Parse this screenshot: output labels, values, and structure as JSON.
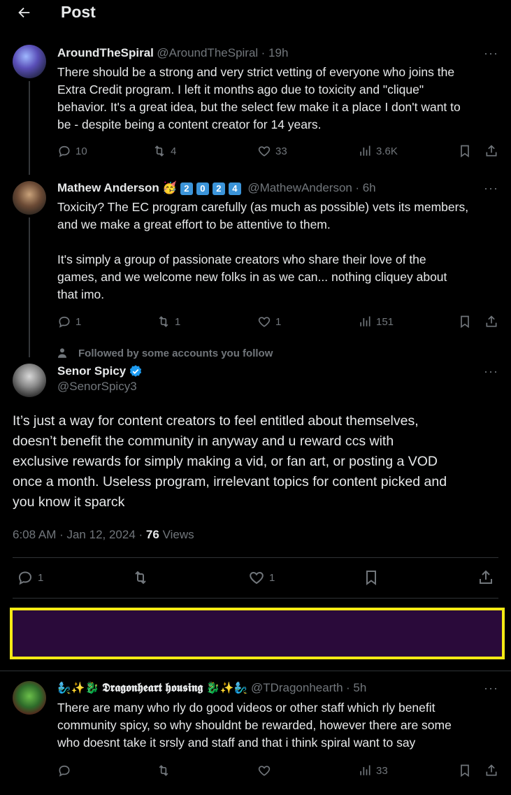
{
  "header": {
    "title": "Post"
  },
  "tweet1": {
    "name": "AroundTheSpiral",
    "handle": "@AroundTheSpiral",
    "time": "· 19h",
    "text_lines": [
      "There should be a strong and very strict vetting of everyone who joins the",
      "Extra Credit program. I left it months ago due to toxicity and \"clique\"",
      "behavior. It's a great idea, but the select few make it a place I don't want to",
      "be - despite being a content creator for 14 years."
    ],
    "replies": "10",
    "reposts": "4",
    "likes": "33",
    "views": "3.6K"
  },
  "tweet2": {
    "name": "Mathew Anderson",
    "emoji": "🥳",
    "badges": [
      "2",
      "0",
      "2",
      "4"
    ],
    "handle": "@MathewAnderson",
    "time": "· 6h",
    "text_lines": [
      "Toxicity? The EC program carefully (as much as possible) vets its members,",
      "and we make a great effort to be attentive to them.",
      "",
      "It's simply a group of passionate creators who share their love of the",
      "games, and we welcome new folks in as we can... nothing cliquey about",
      "that imo."
    ],
    "replies": "1",
    "reposts": "1",
    "likes": "1",
    "views": "151"
  },
  "main": {
    "context": "Followed by some accounts you follow",
    "name": "Senor Spicy",
    "handle": "@SenorSpicy3",
    "text_lines": [
      "It’s just a way for content creators to feel entitled about themselves,",
      "doesn’t benefit the community in anyway and u reward ccs with",
      "exclusive rewards for simply making a vid, or fan art, or posting a VOD",
      "once a month. Useless program, irrelevant topics for content picked and",
      "you know it sparck"
    ],
    "timestamp": "6:08 AM · Jan 12, 2024 ·",
    "views_count": "76",
    "views_label": "Views",
    "replies": "1",
    "likes": "1"
  },
  "tweet3": {
    "name_prefix": "🧞‍♂️✨🐉",
    "name": "𝕯𝖗𝖆𝖌𝖔𝖓𝖍𝖊𝖆𝖗𝖙 𝖍𝖔𝖚𝖘𝖎𝖓𝖌",
    "name_suffix": "🐉✨🧞‍♂️",
    "handle": "@TDragonhearth",
    "time": "· 5h",
    "text_lines": [
      "There are many who rly do good videos or other staff which rly benefit",
      "community spicy, so why shouldnt be rewarded, however there are some",
      "who doesnt take it srsly and staff and that i think spiral want to say"
    ],
    "views": "33"
  },
  "colors": {
    "background": "#000000",
    "text": "#e7e9ea",
    "muted": "#71767b",
    "highlight_border": "#f5ea14",
    "highlight_fill": "#2a0a3a",
    "verified": "#1d9bf0"
  },
  "icons": [
    "back-arrow-icon",
    "reply-icon",
    "repost-icon",
    "like-icon",
    "views-icon",
    "bookmark-icon",
    "share-icon",
    "more-icon",
    "verified-icon",
    "person-icon"
  ]
}
